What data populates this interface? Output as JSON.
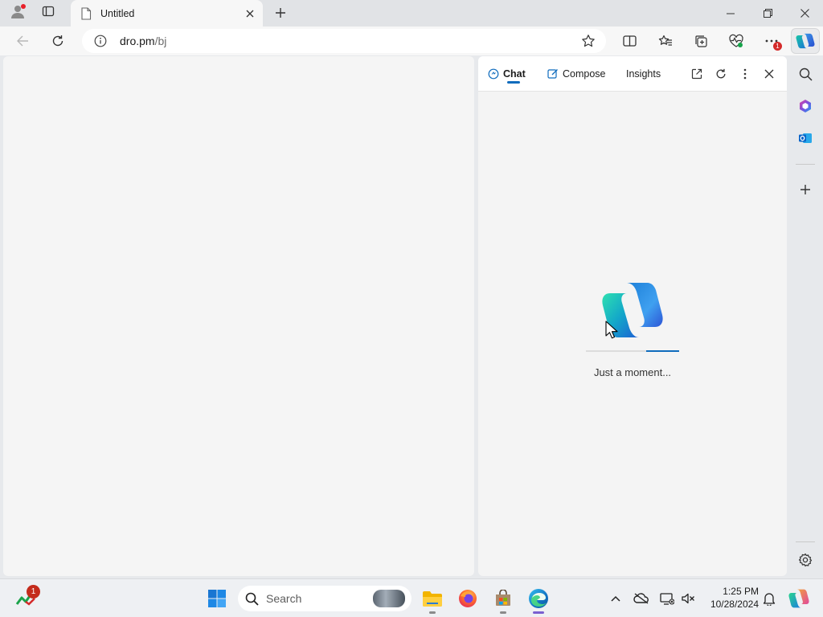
{
  "browser": {
    "tab_title": "Untitled",
    "url_host": "dro.pm",
    "url_path": "/bj",
    "extensions_badge": "1"
  },
  "copilot_pane": {
    "tabs": [
      {
        "label": "Chat",
        "active": true
      },
      {
        "label": "Compose",
        "active": false
      },
      {
        "label": "Insights",
        "active": false
      }
    ],
    "loading_text": "Just a moment...",
    "progress": 0.35,
    "accent_color": "#0f6cbd"
  },
  "taskbar": {
    "widgets_badge": "1",
    "search_label": "Search",
    "clock_time": "1:25 PM",
    "clock_date": "10/28/2024"
  },
  "icons": [
    "profile-icon",
    "tab-actions-icon",
    "page-icon",
    "close-icon",
    "plus-icon",
    "minimize-icon",
    "maximize-icon",
    "back-icon",
    "refresh-icon",
    "info-icon",
    "star-icon",
    "split-screen-icon",
    "favorites-icon",
    "collections-icon",
    "heartbeat-icon",
    "more-icon",
    "copilot-icon",
    "chat-icon",
    "compose-icon",
    "open-new-window-icon",
    "search-icon",
    "m365-icon",
    "outlook-icon",
    "settings-icon",
    "windows-icon",
    "file-explorer-icon",
    "firefox-icon",
    "store-icon",
    "edge-icon",
    "chevron-up-icon",
    "cloud-offline-icon",
    "network-icon",
    "volume-muted-icon",
    "bell-icon"
  ]
}
